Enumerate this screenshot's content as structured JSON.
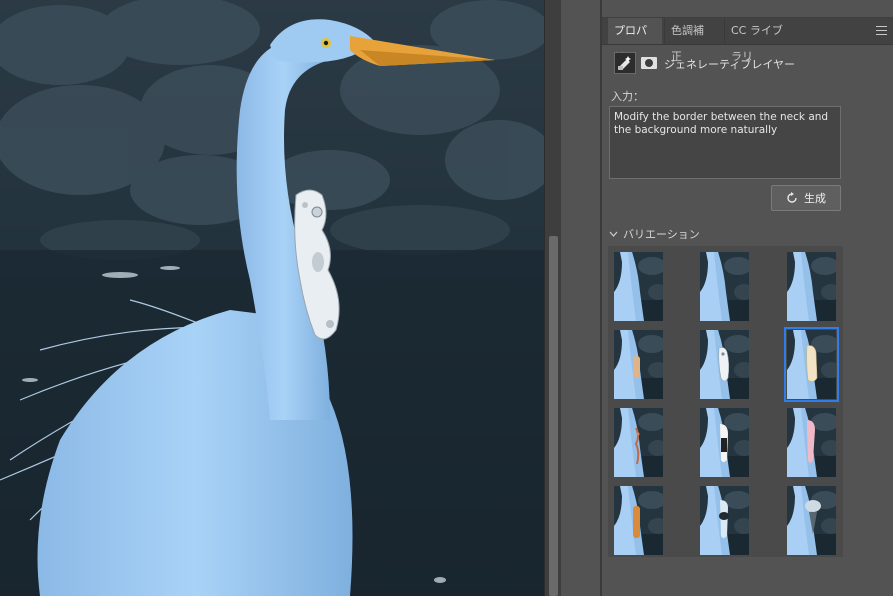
{
  "panel": {
    "tabs": [
      {
        "label": "プロパティ",
        "active": true
      },
      {
        "label": "色調補正",
        "active": false
      },
      {
        "label": "CC ライブラリ",
        "active": false
      }
    ],
    "layer_label": "ジェネレーティブレイヤー",
    "input_label": "入力：",
    "prompt_text": "Modify the border between the neck and the background more naturally",
    "generate_label": "生成",
    "variations_label": "バリエーション",
    "selected_variation": 5,
    "variations": [
      {
        "object": "none"
      },
      {
        "object": "none"
      },
      {
        "object": "none"
      },
      {
        "object": "tan-patch"
      },
      {
        "object": "white-robot-part"
      },
      {
        "object": "cream-sleeve"
      },
      {
        "object": "orange-vine"
      },
      {
        "object": "black-white-strap"
      },
      {
        "object": "pink-tube"
      },
      {
        "object": "orange-tube"
      },
      {
        "object": "dark-ring"
      },
      {
        "object": "grey-beak"
      }
    ]
  },
  "colors": {
    "accent_selected": "#2f7de6",
    "panel_bg": "#535353",
    "tab_bg": "#424242"
  }
}
